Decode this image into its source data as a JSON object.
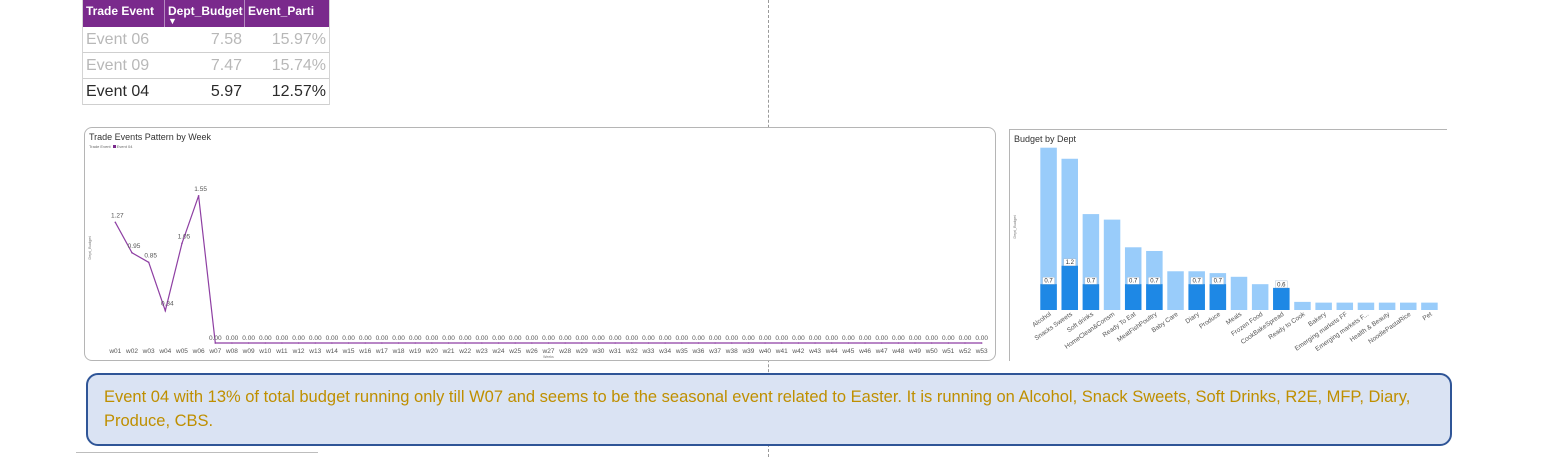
{
  "table": {
    "headers": [
      "Trade Event",
      "Dept_Budget",
      "Event_Parti"
    ],
    "rows": [
      {
        "event": "Event 06",
        "budget": "7.58",
        "share": "15.97%"
      },
      {
        "event": "Event 09",
        "budget": "7.47",
        "share": "15.74%"
      },
      {
        "event": "Event 04",
        "budget": "5.97",
        "share": "12.57%"
      }
    ]
  },
  "chart_data": [
    {
      "type": "line",
      "title": "Trade Events Pattern by Week",
      "legend": {
        "label": "Trade Event",
        "series": "Event 04"
      },
      "xlabel": "Weeks",
      "ylabel": "Dept_Budget",
      "color": "#8e3fa3",
      "categories": [
        "w01",
        "w02",
        "w03",
        "w04",
        "w05",
        "w06",
        "w07",
        "w08",
        "w09",
        "w10",
        "w11",
        "w12",
        "w13",
        "w14",
        "w15",
        "w16",
        "w17",
        "w18",
        "w19",
        "w20",
        "w21",
        "w22",
        "w23",
        "w24",
        "w25",
        "w26",
        "w27",
        "w28",
        "w29",
        "w30",
        "w31",
        "w32",
        "w33",
        "w34",
        "w35",
        "w36",
        "w37",
        "w38",
        "w39",
        "w40",
        "w41",
        "w42",
        "w43",
        "w44",
        "w45",
        "w46",
        "w47",
        "w48",
        "w49",
        "w50",
        "w51",
        "w52",
        "w53"
      ],
      "values": [
        1.27,
        0.95,
        0.85,
        0.34,
        1.05,
        1.55,
        0,
        0,
        0,
        0,
        0,
        0,
        0,
        0,
        0,
        0,
        0,
        0,
        0,
        0,
        0,
        0,
        0,
        0,
        0,
        0,
        0,
        0,
        0,
        0,
        0,
        0,
        0,
        0,
        0,
        0,
        0,
        0,
        0,
        0,
        0,
        0,
        0,
        0,
        0,
        0,
        0,
        0,
        0,
        0,
        0,
        0,
        0
      ],
      "data_labels": [
        "1.27",
        "0.95",
        "0.85",
        "0.34",
        "1.05",
        "1.55",
        "0.00",
        "0.00",
        "0.00",
        "0.00",
        "0.00",
        "0.00",
        "0.00",
        "0.00",
        "0.00",
        "0.00",
        "0.00",
        "0.00",
        "0.00",
        "0.00",
        "0.00",
        "0.00",
        "0.00",
        "0.00",
        "0.00",
        "0.00",
        "0.00",
        "0.00",
        "0.00",
        "0.00",
        "0.00",
        "0.00",
        "0.00",
        "0.00",
        "0.00",
        "0.00",
        "0.00",
        "0.00",
        "0.00",
        "0.00",
        "0.00",
        "0.00",
        "0.00",
        "0.00",
        "0.00",
        "0.00",
        "0.00",
        "0.00",
        "0.00",
        "0.00",
        "0.00",
        "0.00",
        "0.00"
      ],
      "ylim": [
        0,
        2
      ]
    },
    {
      "type": "bar",
      "title": "Budget by Dept",
      "ylabel": "Dept_Budget",
      "colors": {
        "total": "#99ccfa",
        "event": "#1e88e5"
      },
      "categories": [
        "Alcohol",
        "Snacks Sweets",
        "Soft drinks",
        "HomeClean&Consm",
        "Ready To Eat",
        "MeatFishPoultry",
        "Baby Care",
        "Diary",
        "Produce",
        "Meals",
        "Frozen Food",
        "CookBakeSpread",
        "Ready to Cook",
        "Bakery",
        "Emerging markets FF",
        "Emerging markets F...",
        "Health & Beauty",
        "NoodlePastaRice",
        "Pet"
      ],
      "series": [
        {
          "values": [
            4.4,
            4.1,
            2.6,
            2.45,
            1.7,
            1.6,
            1.05,
            1.05,
            1.0,
            0.9,
            0.7,
            0.55,
            0.22,
            0.2,
            0.2,
            0.2,
            0.2,
            0.2,
            0.2
          ]
        },
        {
          "values": [
            0.7,
            1.2,
            0.7,
            0,
            0.7,
            0.7,
            0,
            0.7,
            0.7,
            0,
            0,
            0.6,
            0,
            0,
            0,
            0,
            0,
            0,
            0
          ]
        }
      ],
      "data_labels": [
        "0.7",
        "1.2",
        "0.7",
        "",
        "0.7",
        "0.7",
        "",
        "0.7",
        "0.7",
        "",
        "",
        "0.6",
        "",
        "",
        "",
        "",
        "",
        "",
        ""
      ],
      "ylim": [
        0,
        4.5
      ]
    }
  ],
  "note": "Event 04 with 13% of total budget running only till W07 and seems to be the seasonal event related to Easter. It is running on Alcohol, Snack Sweets, Soft Drinks, R2E, MFP, Diary, Produce, CBS."
}
